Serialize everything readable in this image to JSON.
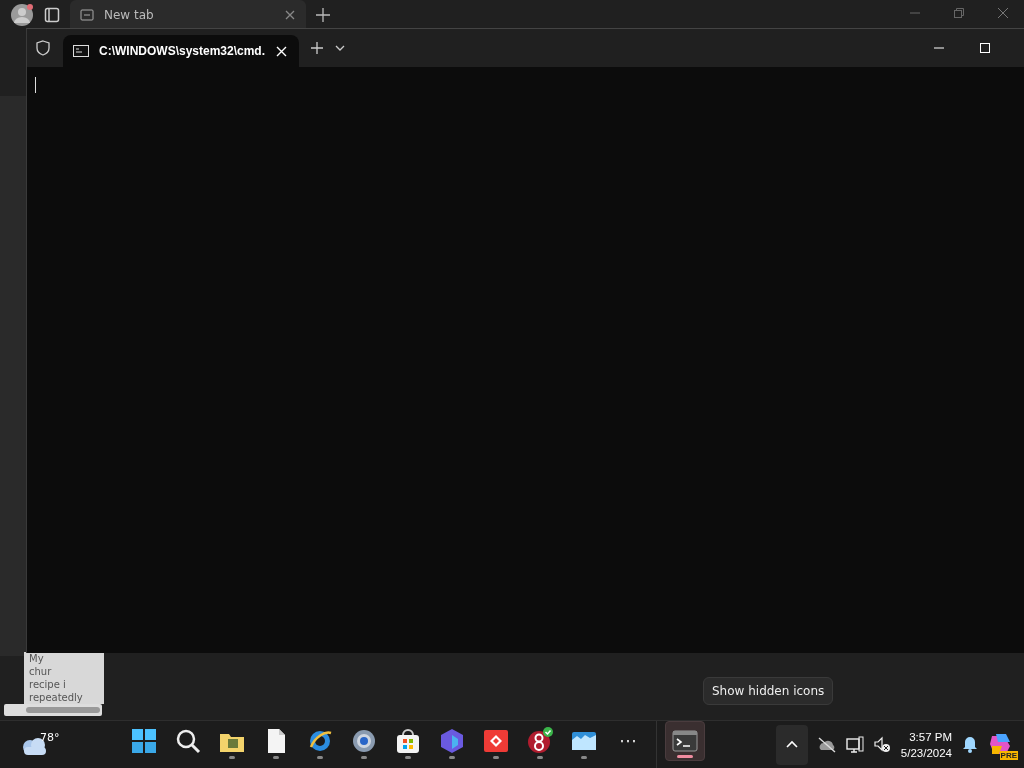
{
  "browser": {
    "tab": {
      "title": "New tab"
    },
    "page_fragments": [
      "My",
      "chur",
      "recipe i",
      "repeatedly"
    ]
  },
  "terminal": {
    "tab": {
      "title": "C:\\WINDOWS\\system32\\cmd."
    }
  },
  "taskbar": {
    "weather": {
      "temperature": "78°"
    },
    "apps": [
      {
        "selected": false
      },
      {
        "selected": false
      },
      {
        "selected": false
      },
      {
        "selected": false
      },
      {
        "selected": false
      },
      {
        "selected": false
      },
      {
        "selected": false
      },
      {
        "selected": false
      },
      {
        "selected": false
      },
      {
        "selected": false
      },
      {
        "selected": false
      },
      {
        "selected": true
      }
    ],
    "more": "⋯",
    "tray": {
      "time": "3:57 PM",
      "date": "5/23/2024",
      "badge": "PRE"
    }
  },
  "tooltip": {
    "text": "Show hidden icons"
  }
}
